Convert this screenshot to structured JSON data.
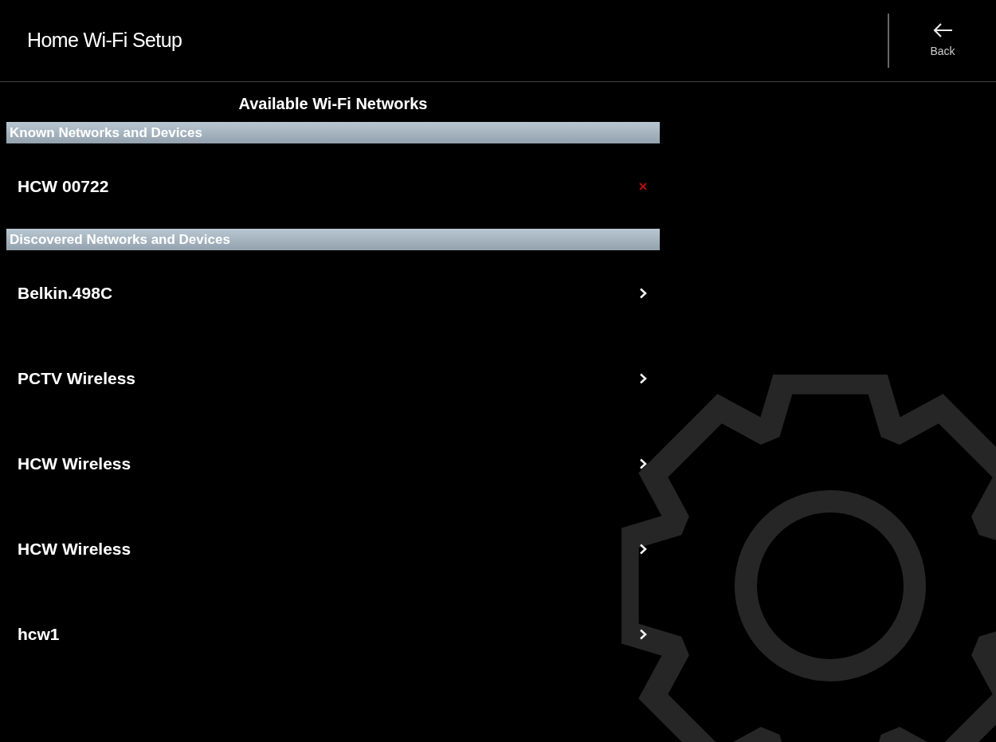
{
  "header": {
    "title": "Home Wi-Fi Setup",
    "back_label": "Back"
  },
  "heading": "Available Wi-Fi Networks",
  "sections": [
    {
      "title": "Known Networks and Devices",
      "items": [
        {
          "name": "HCW 00722",
          "kind": "known"
        }
      ]
    },
    {
      "title": "Discovered Networks and Devices",
      "items": [
        {
          "name": "Belkin.498C",
          "kind": "discovered"
        },
        {
          "name": "PCTV Wireless",
          "kind": "discovered"
        },
        {
          "name": "HCW Wireless",
          "kind": "discovered"
        },
        {
          "name": "HCW Wireless",
          "kind": "discovered"
        },
        {
          "name": "hcw1",
          "kind": "discovered"
        }
      ]
    }
  ]
}
